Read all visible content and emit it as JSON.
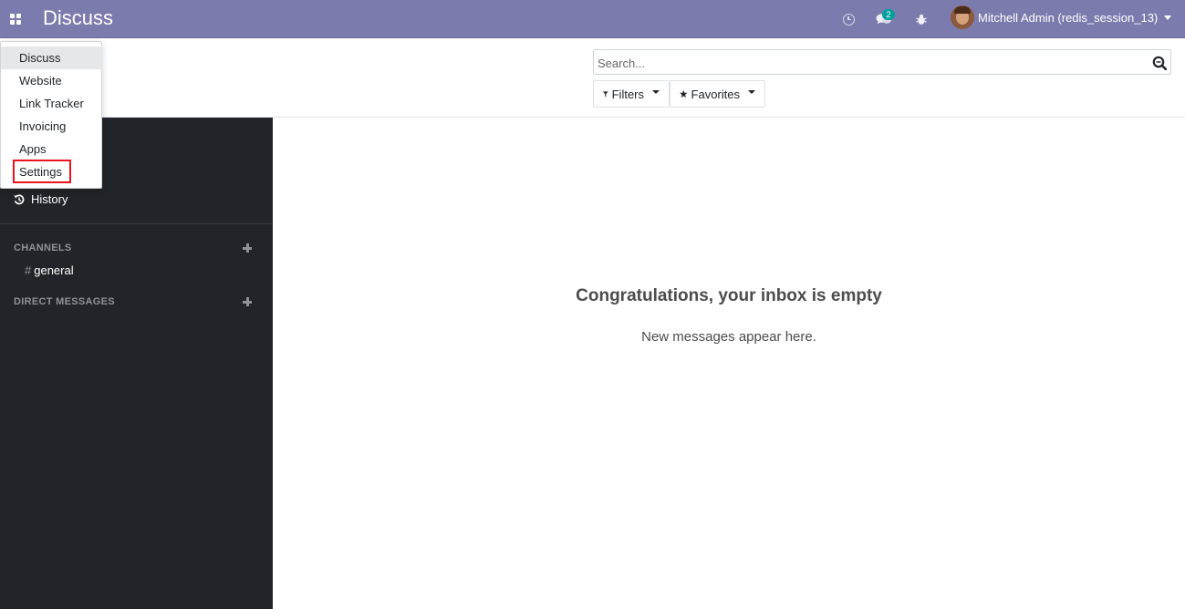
{
  "navbar": {
    "brand": "Discuss",
    "chat_badge": "2",
    "user_name": "Mitchell Admin (redis_session_13)"
  },
  "search": {
    "placeholder": "Search..."
  },
  "buttons": {
    "filters": "Filters",
    "favorites": "Favorites"
  },
  "sidebar": {
    "history": "History",
    "channels_title": "CHANNELS",
    "channels": [
      {
        "hash": "#",
        "name": "general"
      }
    ],
    "direct_messages_title": "DIRECT MESSAGES"
  },
  "main": {
    "empty_title": "Congratulations, your inbox is empty",
    "empty_subtitle": "New messages appear here."
  },
  "apps_menu": {
    "items": [
      {
        "label": "Discuss"
      },
      {
        "label": "Website"
      },
      {
        "label": "Link Tracker"
      },
      {
        "label": "Invoicing"
      },
      {
        "label": "Apps"
      },
      {
        "label": "Settings"
      }
    ]
  },
  "colors": {
    "navbar": "#7c7bad",
    "sidebar": "#212529",
    "badge": "#00a09d",
    "highlight": "#e8141e"
  }
}
